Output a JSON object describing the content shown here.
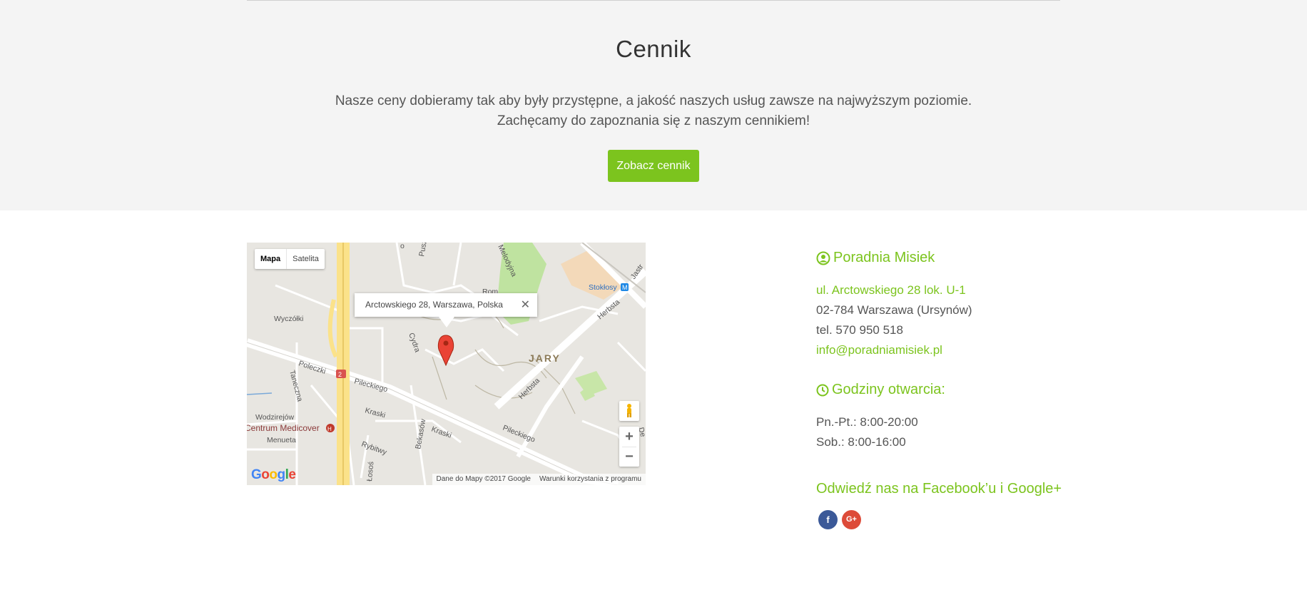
{
  "pricing": {
    "title": "Cennik",
    "line1": "Nasze ceny dobieramy tak aby były przystępne, a jakość naszych usług zawsze na najwyższym poziomie.",
    "line2": "Zachęcamy do zapoznania się z naszym cennikiem!",
    "button_label": "Zobacz cennik"
  },
  "map": {
    "type_map": "Mapa",
    "type_satellite": "Satelita",
    "info_address": "Arctowskiego 28, Warszawa, Polska",
    "close_glyph": "✕",
    "zoom_in": "+",
    "zoom_out": "−",
    "logo": {
      "G": "G",
      "o1": "o",
      "o2": "o",
      "g": "g",
      "l": "l",
      "e": "e"
    },
    "attribution": "Dane do Mapy ©2017 Google",
    "terms": "Warunki korzystania z programu",
    "labels": {
      "jary": "JARY",
      "stoklosy": "Stokłosy",
      "stoklosy_metro": "M",
      "herbsta_top": "Herbsta",
      "herbsta_mid": "Herbsta",
      "pileckiego_left": "Pileckiego",
      "pileckiego_right": "Pileckiego",
      "poleczki": "Poleczki",
      "wyczolki": "Wyczółki",
      "taneczna": "Taneczna",
      "wodzirejow": "Wodzirejów",
      "medicover": "Centrum Medicover",
      "medicover_badge": "H",
      "menueta": "Menueta",
      "kraski_left": "Kraski",
      "kraski_right": "Kraski",
      "bekasow": "Bekasów",
      "rybitwy": "Rybitwy",
      "cydra": "Cydra",
      "roma": "Rom",
      "puszczyka": "Puszc",
      "melodyjna": "Melodyjna",
      "jastrzebowskiego": "Jastr",
      "de": "De",
      "sosnowa": "Łosoś",
      "o_street": "o",
      "route_badge": "2"
    }
  },
  "contact": {
    "name": "Poradnia Misiek",
    "address1": "ul. Arctowskiego 28 lok. U-1",
    "address2": "02-784 Warszawa (Ursynów)",
    "phone": "tel. 570 950 518",
    "email": "info@poradniamisiek.pl",
    "hours_title": "Godziny otwarcia:",
    "hours_weekdays": "Pn.-Pt.: 8:00-20:00",
    "hours_saturday": "Sob.: 8:00-16:00",
    "social_title": "Odwiedź nas na Facebook’u i Google+",
    "facebook_glyph": "f",
    "googleplus_glyph": "G+"
  },
  "colors": {
    "accent": "#7cc41e",
    "facebook": "#3b5998",
    "googleplus": "#dd4b39",
    "band": "#f4f4f4"
  },
  "icons": [
    "user-circle-icon",
    "clock-icon",
    "facebook-icon",
    "google-plus-icon",
    "map-marker-icon",
    "pegman-icon",
    "close-icon"
  ]
}
